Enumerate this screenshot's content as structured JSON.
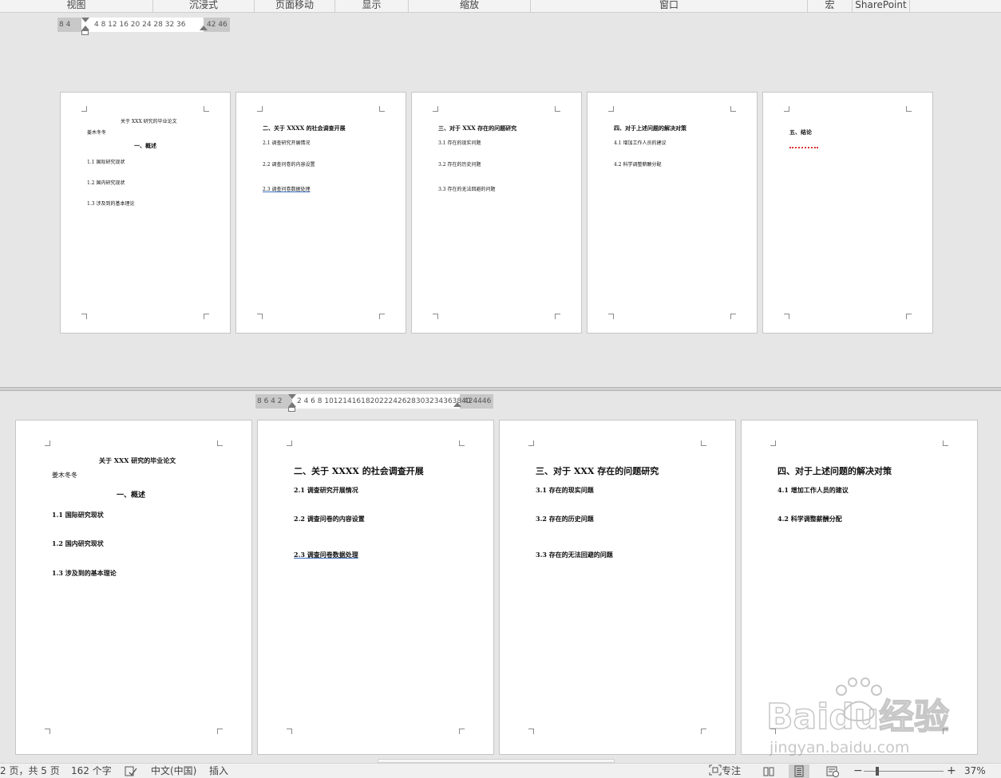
{
  "ribbon": {
    "groups": [
      "视图",
      "沉浸式",
      "页面移动",
      "显示",
      "缩放",
      "窗口",
      "宏",
      "SharePoint"
    ]
  },
  "top_ruler": {
    "left_numbers": "8  4",
    "numbers": "4   8  12 16 20 24 28 32  36",
    "right_numbers": "42 46"
  },
  "bottom_ruler": {
    "left_numbers": "8 6 4 2",
    "numbers": "2  4  6  8 10121416182022242628303234363840",
    "right_numbers": "424446"
  },
  "pages": [
    {
      "title": "关于 XXX 研究的毕业论文",
      "author": "姜木冬冬",
      "heading": "一、概述",
      "items": [
        "1.1 国际研究现状",
        "1.2 国内研究现状",
        "1.3 涉及到的基本理论"
      ]
    },
    {
      "heading": "二、关于 XXXX 的社会调查开展",
      "items": [
        "2.1 调查研究开展情况",
        "2.2 调查问卷的内容设置",
        "2.3 调查问卷数据处理"
      ]
    },
    {
      "heading": "三、对于 XXX 存在的问题研究",
      "items": [
        "3.1 存在的现实问题",
        "3.2 存在的历史问题",
        "3.3 存在的无法回避的问题"
      ]
    },
    {
      "heading": "四、对于上述问题的解决对策",
      "items": [
        "4.1 增加工作人员的建议",
        "4.2 科学调整薪酬分配"
      ]
    },
    {
      "heading": "五、结论",
      "items": []
    }
  ],
  "status": {
    "page": "2 页，共 5 页",
    "words": "162 个字",
    "language": "中文(中国)",
    "mode": "插入",
    "focus": "专注",
    "zoom_minus": "−",
    "zoom_plus": "+",
    "zoom": "37%"
  },
  "watermark": {
    "brand": "Baidu经验",
    "url": "jingyan.baidu.com"
  }
}
